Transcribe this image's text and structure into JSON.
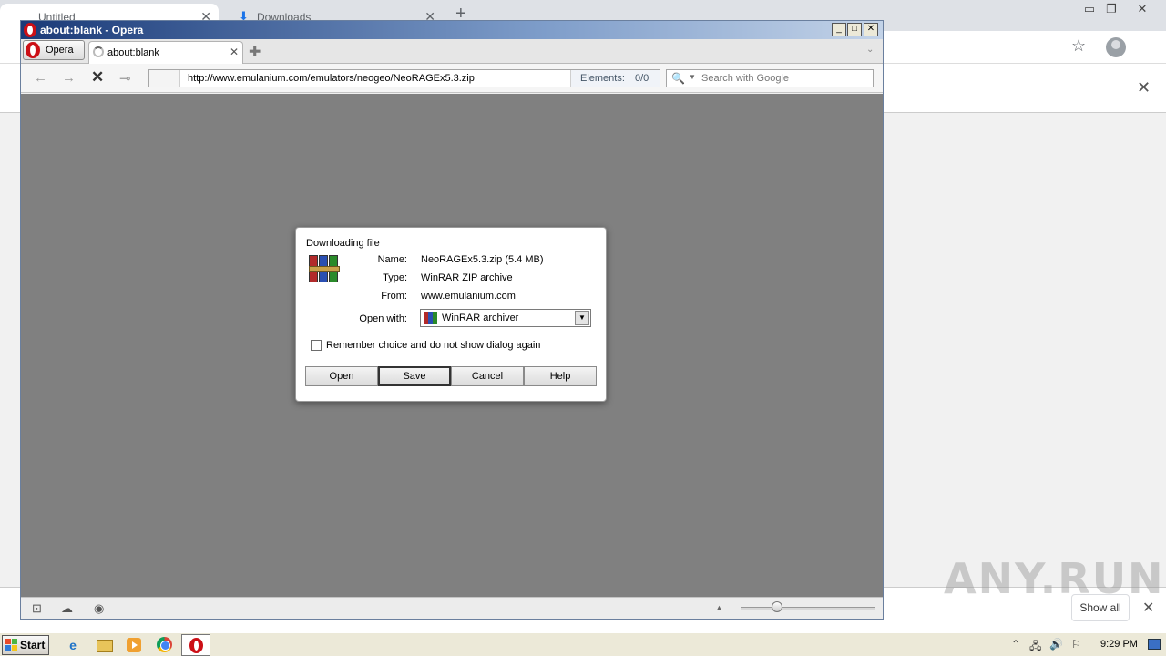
{
  "chrome": {
    "tabs": [
      {
        "label": "Untitled"
      },
      {
        "label": "Downloads"
      }
    ],
    "show_all_label": "Show all"
  },
  "watermark": "ANY.RUN",
  "opera": {
    "window_title": "about:blank - Opera",
    "menu_label": "Opera",
    "tab_label": "about:blank",
    "address": {
      "url": "http://www.emulanium.com/emulators/neogeo/NeoRAGEx5.3.zip",
      "elements_label": "Elements:",
      "elements_value": "0/0"
    },
    "search_placeholder": "Search with Google",
    "viewport_color": "#808080"
  },
  "dialog": {
    "title": "Downloading file",
    "name_label": "Name:",
    "name_value": "NeoRAGEx5.3.zip (5.4 MB)",
    "type_label": "Type:",
    "type_value": "WinRAR ZIP archive",
    "from_label": "From:",
    "from_value": "www.emulanium.com",
    "open_with_label": "Open with:",
    "open_with_value": "WinRAR archiver",
    "remember_label": "Remember choice and do not show dialog again",
    "remember_checked": false,
    "buttons": {
      "open": "Open",
      "save": "Save",
      "cancel": "Cancel",
      "help": "Help"
    }
  },
  "taskbar": {
    "start_label": "Start",
    "clock": "9:29 PM"
  }
}
